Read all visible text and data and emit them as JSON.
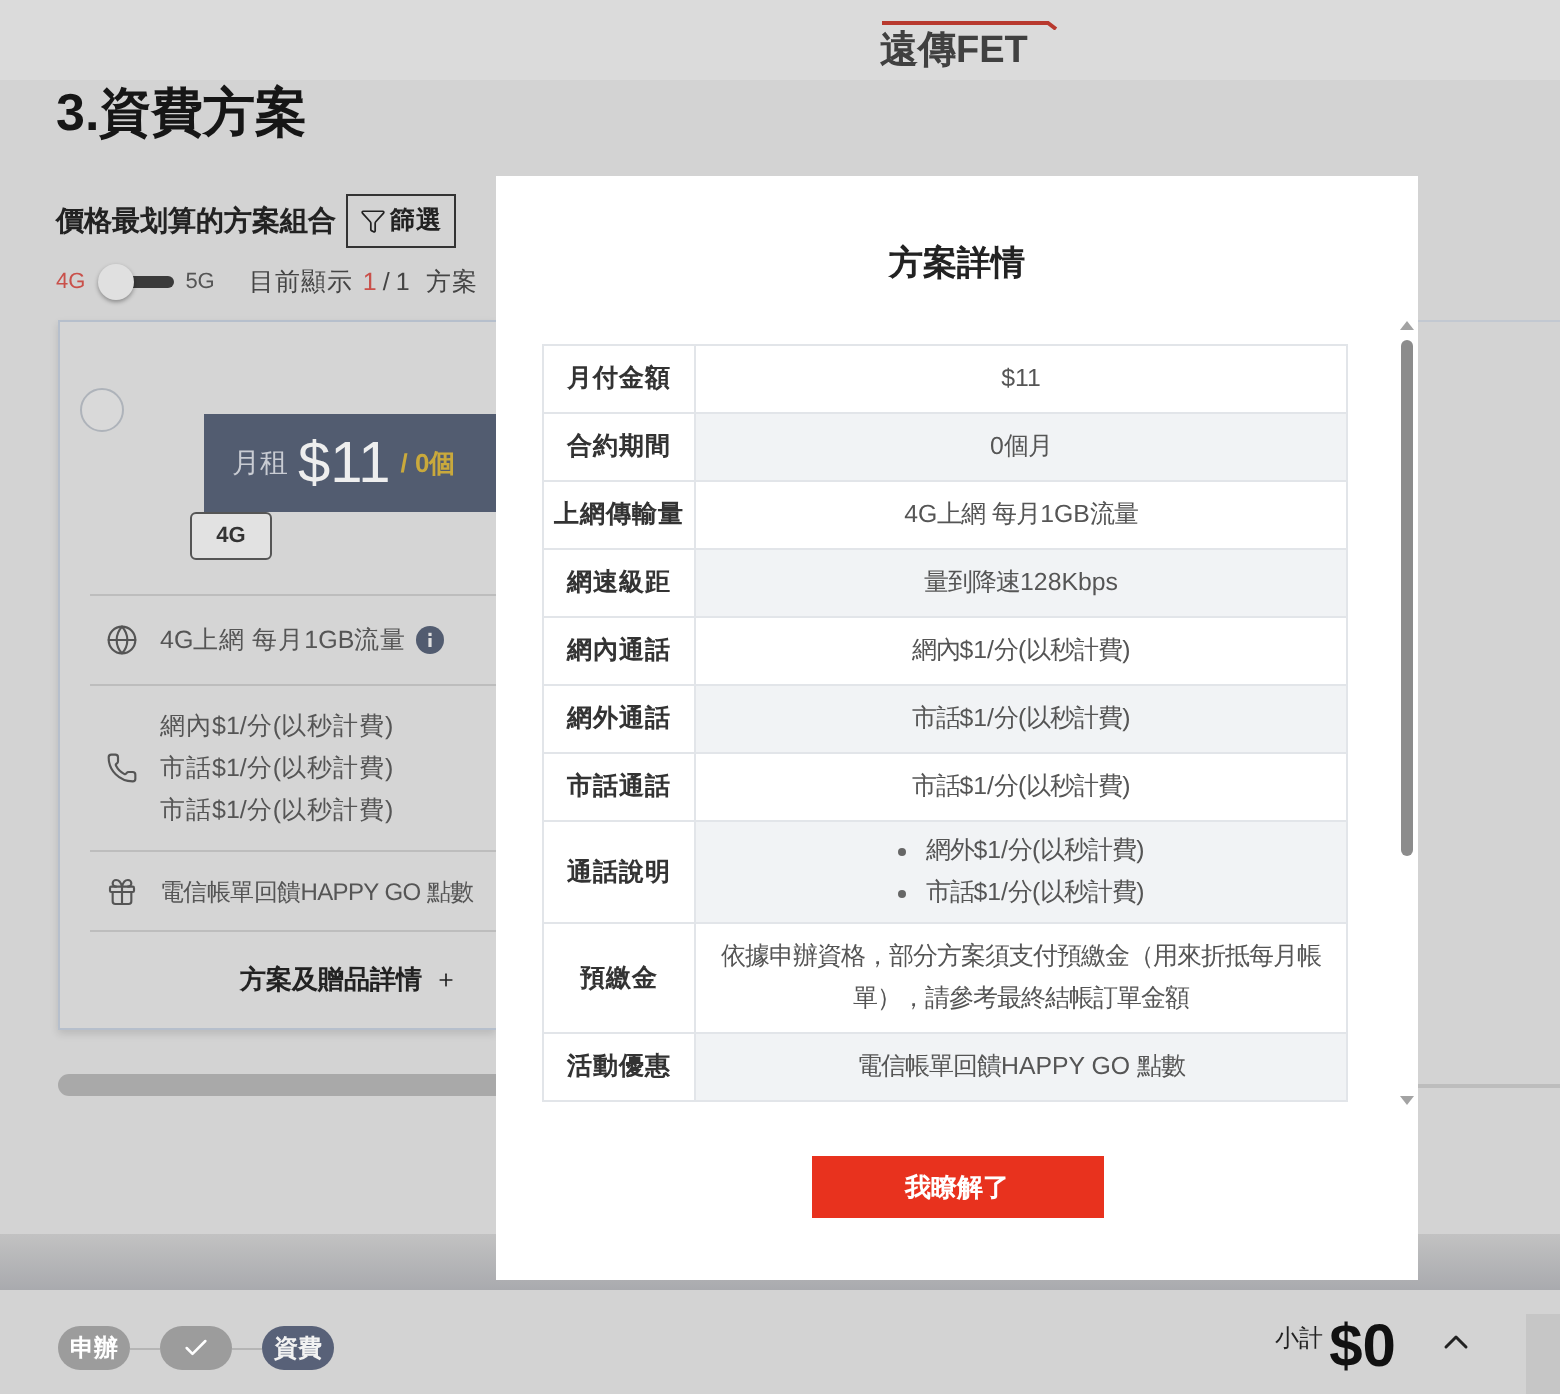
{
  "header": {
    "logo": "遠傳FET"
  },
  "section": {
    "title": "3.資費方案",
    "subtitle": "價格最划算的方案組合",
    "filter_button": "篩選"
  },
  "network_toggle": {
    "options": [
      {
        "label": "4G",
        "selected": true
      },
      {
        "label": "5G",
        "selected": false
      }
    ]
  },
  "result_count": {
    "prefix": "目前顯示",
    "current": "1",
    "separator": "/",
    "total": "1",
    "suffix": "方案"
  },
  "plan_card": {
    "selected": false,
    "rent_label": "月租",
    "price": "$11",
    "period": "/ 0個",
    "network_badge": "4G",
    "data_allowance": "4G上網 每月1GB流量",
    "calls": [
      "網內$1/分(以秒計費)",
      "市話$1/分(以秒計費)",
      "市話$1/分(以秒計費)"
    ],
    "gift": "電信帳單回饋HAPPY GO 點數",
    "details_link": "方案及贈品詳情"
  },
  "modal": {
    "title": "方案詳情",
    "rows": [
      {
        "kind": "text",
        "label": "月付金額",
        "value": "$11"
      },
      {
        "kind": "text",
        "label": "合約期間",
        "value": "0個月"
      },
      {
        "kind": "text",
        "label": "上網傳輸量",
        "value": "4G上網 每月1GB流量"
      },
      {
        "kind": "text",
        "label": "網速級距",
        "value": "量到降速128Kbps"
      },
      {
        "kind": "text",
        "label": "網內通話",
        "value": "網內$1/分(以秒計費)"
      },
      {
        "kind": "text",
        "label": "網外通話",
        "value": "市話$1/分(以秒計費)"
      },
      {
        "kind": "text",
        "label": "市話通話",
        "value": "市話$1/分(以秒計費)"
      },
      {
        "kind": "list",
        "label": "通話說明",
        "items": [
          "網外$1/分(以秒計費)",
          "市話$1/分(以秒計費)"
        ]
      },
      {
        "kind": "text",
        "label": "預繳金",
        "value": "依據申辦資格，部分方案須支付預繳金（用來折抵每月帳單），請參考最終結帳訂單金額"
      },
      {
        "kind": "text",
        "label": "活動優惠",
        "value": "電信帳單回饋HAPPY GO 點數"
      }
    ],
    "confirm_button": "我瞭解了"
  },
  "bottom_bar": {
    "steps": [
      {
        "kind": "text",
        "label": "申辦",
        "selected": false
      },
      {
        "kind": "check",
        "selected": false
      },
      {
        "kind": "text",
        "label": "資費",
        "selected": true
      }
    ],
    "subtotal_label": "小計",
    "subtotal": "$0"
  }
}
